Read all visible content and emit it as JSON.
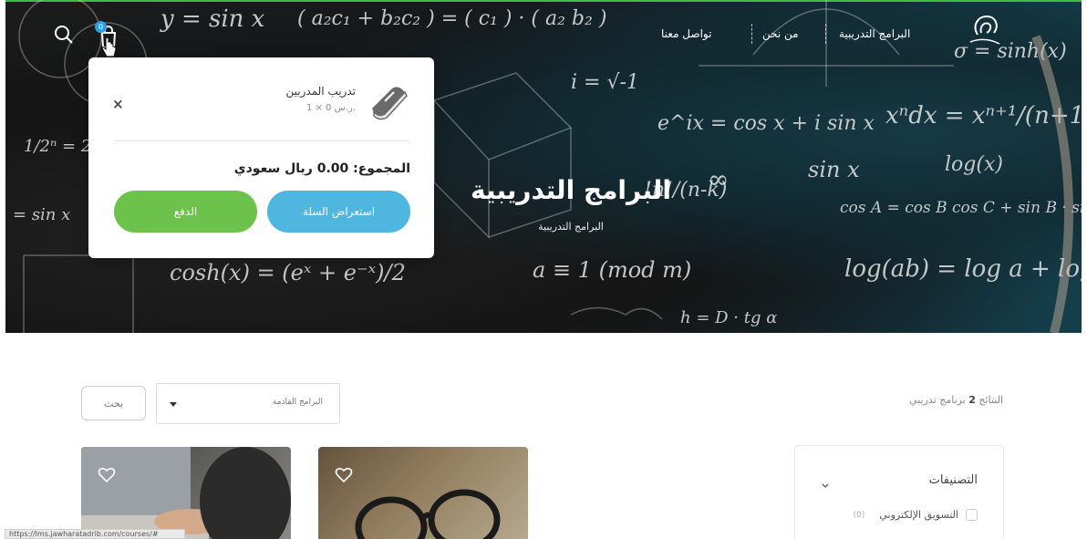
{
  "nav": {
    "items": [
      {
        "label": "البرامج التدريبية"
      },
      {
        "label": "من نحن"
      },
      {
        "label": "تواصل معنا"
      }
    ]
  },
  "cart": {
    "badge": "0",
    "item_title": "تدريب المدربين",
    "item_qty": "1 × 0 ر.س.",
    "remove": "×",
    "total": "المجموع: 0.00 ريال سعودي",
    "view_label": "استعراض السلة",
    "checkout_label": "الدفع"
  },
  "hero": {
    "title": "البرامج التدريبية",
    "breadcrumb": "البرامج التدريبية"
  },
  "toolbar": {
    "results_prefix": "النتائج",
    "results_count": "2",
    "results_suffix": "برنامج تدريبي",
    "select_value": "البرامج القادمة",
    "search_label": "بحث"
  },
  "sidebar": {
    "categories_title": "التصنيفات",
    "items": [
      {
        "label": "التسويق الإلكتروني",
        "count": "(0)"
      }
    ]
  },
  "status_bar": {
    "url": "https://lms.jawharatadrib.com/courses/#"
  },
  "colors": {
    "view_button": "#4fb6df",
    "checkout_button": "#6cc24a",
    "badge": "#2aa1e6",
    "top_border": "#3fbf3f"
  },
  "icons": {
    "search": "search-icon",
    "cart": "cart-icon",
    "book": "book-icon",
    "heart": "heart-icon",
    "chevron": "chevron-down-icon"
  }
}
